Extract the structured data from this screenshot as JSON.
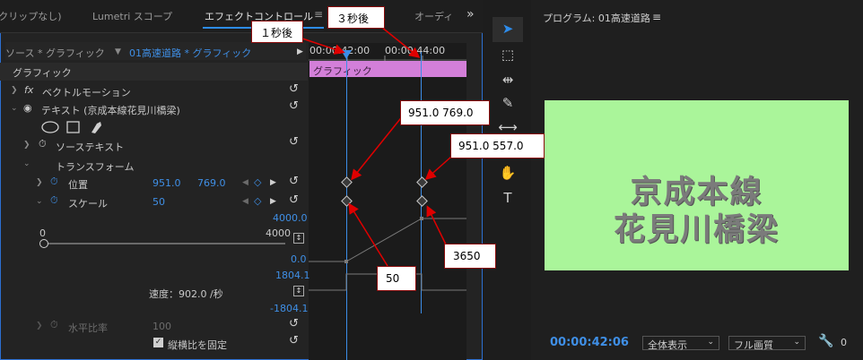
{
  "tabs": [
    "(クリップなし)",
    "Lumetri スコープ",
    "エフェクトコントロール",
    "オーディ"
  ],
  "menu_glyph": "≡",
  "overflow_glyph": "»",
  "source": {
    "selector": "ソース * グラフィック",
    "clip": "01高速道路 * グラフィック"
  },
  "timeline": {
    "t1": "00:00:42:00",
    "t2": "00:00:44:00",
    "clip_label": "グラフィック"
  },
  "section": {
    "graphics": "グラフィック"
  },
  "params": {
    "vector_motion": "ベクトルモーション",
    "text_layer": "テキスト (京成本線花見川橋梁)",
    "source_text": "ソーステキスト",
    "transform": "トランスフォーム",
    "position": {
      "label": "位置",
      "x": "951.0",
      "y": "769.0"
    },
    "scale": {
      "label": "スケール",
      "value": "50"
    },
    "scale_graph_max": "4000.0",
    "scale_graph_min": "0.0",
    "slider_min": "0",
    "slider_max": "4000",
    "velocity_max": "1804.1",
    "velocity_min": "-1804.1",
    "velocity": "速度：902.0 /秒",
    "horizontal_ratio": {
      "label": "水平比率",
      "value": "100"
    },
    "uniform_scale": "縦横比を固定"
  },
  "callouts": {
    "sec1": "１秒後",
    "sec3": "３秒後",
    "pos1": "951.0    769.0",
    "pos2": "951.0    557.0",
    "scale1": "50",
    "scale2": "3650"
  },
  "program": {
    "title": "プログラム: 01高速道路",
    "text_line1": "京成本線",
    "text_line2": "花見川橋梁",
    "timecode": "00:00:42:06",
    "zoom": "全体表示",
    "quality": "フル画質",
    "extra": "0"
  },
  "colors": {
    "accent": "#2d8ceb",
    "preview_bg": "#aaf59a",
    "clip": "#d37fd9",
    "callout_border": "#8b0d0d"
  }
}
